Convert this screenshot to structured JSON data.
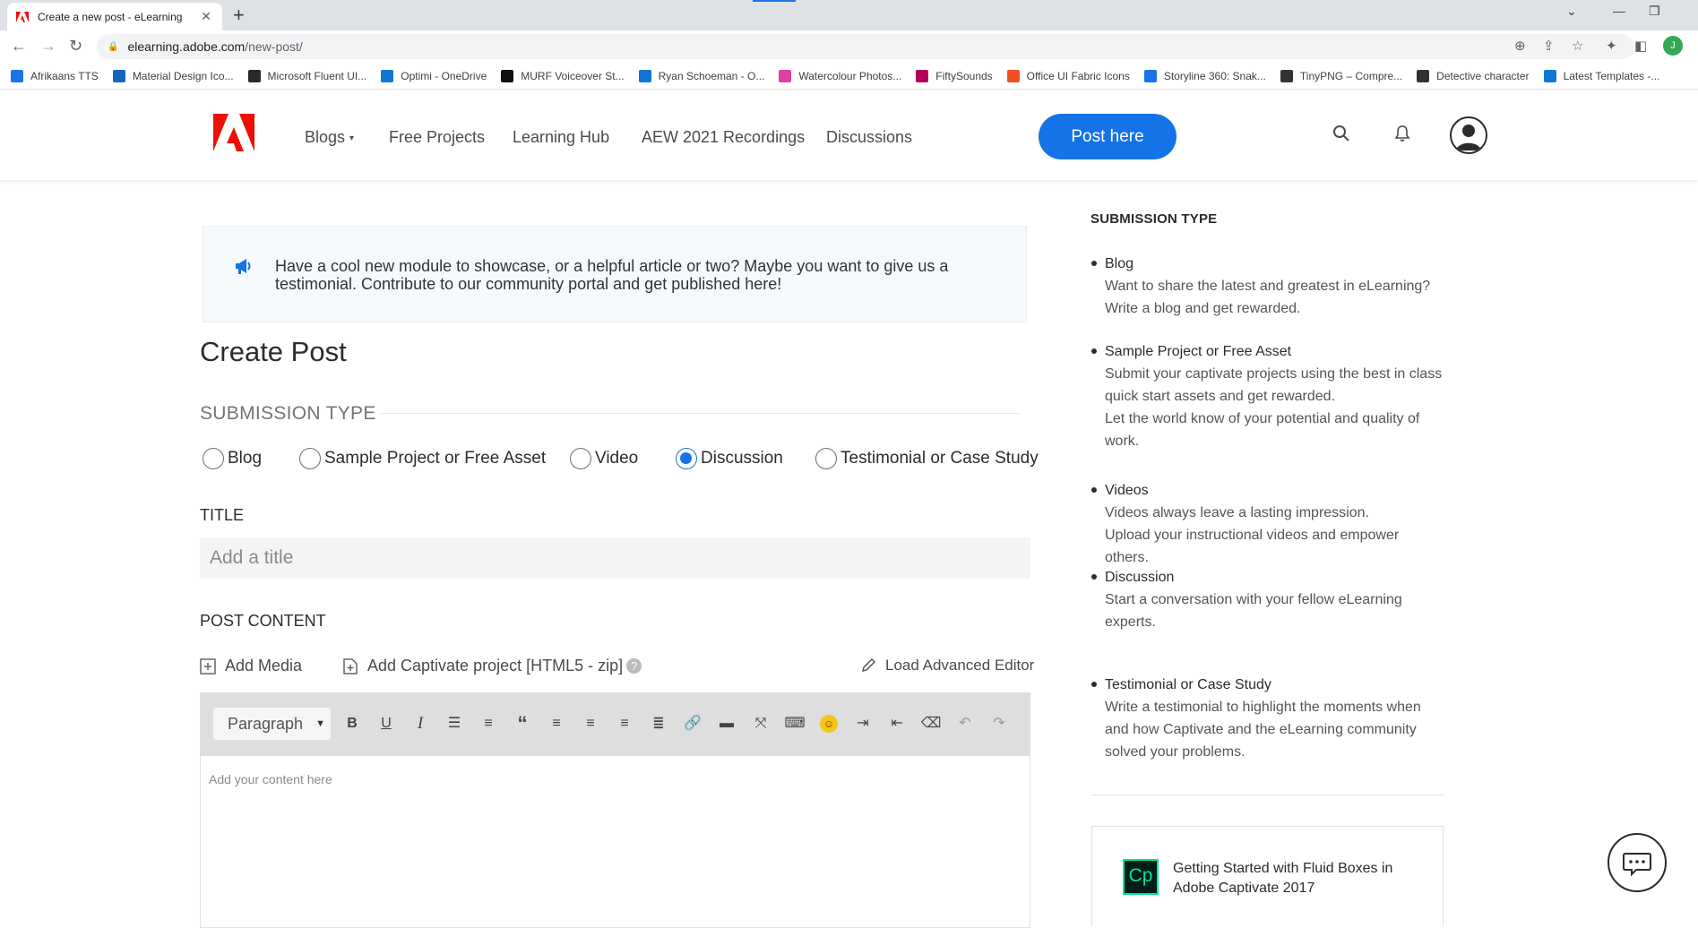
{
  "browser": {
    "tab_title": "Create a new post - eLearning",
    "url_host": "elearning.adobe.com",
    "url_path": "/new-post/",
    "profile_initial": "J",
    "bookmarks": [
      {
        "label": "Afrikaans TTS",
        "color": "#1a73e8"
      },
      {
        "label": "Material Design Ico...",
        "color": "#1565c0"
      },
      {
        "label": "Microsoft Fluent UI...",
        "color": "#24292e"
      },
      {
        "label": "Optimi - OneDrive",
        "color": "#0f78d4"
      },
      {
        "label": "MURF Voiceover St...",
        "color": "#111111"
      },
      {
        "label": "Ryan Schoeman - O...",
        "color": "#0f78d4"
      },
      {
        "label": "Watercolour Photos...",
        "color": "#e040a0"
      },
      {
        "label": "FiftySounds",
        "color": "#b4005a"
      },
      {
        "label": "Office UI Fabric Icons",
        "color": "#f25022"
      },
      {
        "label": "Storyline 360: Snak...",
        "color": "#1a73e8"
      },
      {
        "label": "TinyPNG – Compre...",
        "color": "#333333"
      },
      {
        "label": "Detective character",
        "color": "#333333"
      },
      {
        "label": "Latest Templates -...",
        "color": "#0f78d4"
      }
    ]
  },
  "header": {
    "nav": [
      "Blogs",
      "Free Projects",
      "Learning Hub",
      "AEW 2021 Recordings",
      "Discussions"
    ],
    "post_here": "Post here",
    "accent": "#1473e6",
    "brand_red": "#eb1000"
  },
  "banner": {
    "text": "Have a cool new module to showcase, or a helpful article or two? Maybe you want to give us a testimonial. Contribute to our community portal and get published here!"
  },
  "form": {
    "page_title": "Create Post",
    "submission_label": "SUBMISSION TYPE",
    "types": [
      "Blog",
      "Sample Project or Free Asset",
      "Video",
      "Discussion",
      "Testimonial or Case Study"
    ],
    "selected_type": "Discussion",
    "title_label": "TITLE",
    "title_placeholder": "Add a title",
    "content_label": "POST CONTENT",
    "add_media": "Add Media",
    "add_captivate": "Add Captivate project [HTML5 - zip]",
    "load_editor": "Load Advanced Editor",
    "paragraph": "Paragraph",
    "content_placeholder": "Add your content here"
  },
  "sidebar": {
    "heading": "SUBMISSION TYPE",
    "items": [
      {
        "title": "Blog",
        "lines": [
          "Want to share the latest and greatest in eLearning?",
          "Write a blog and get rewarded."
        ]
      },
      {
        "title": "Sample Project or Free Asset",
        "lines": [
          "Submit your captivate projects using the best in class",
          "quick start assets and get rewarded.",
          "Let the world know of your potential and quality of",
          "work."
        ]
      },
      {
        "title": "Videos",
        "lines": [
          "Videos always leave a lasting impression.",
          "Upload your instructional videos and empower",
          "others."
        ]
      },
      {
        "title": "Discussion",
        "lines": [
          "Start a conversation with your fellow eLearning",
          "experts."
        ]
      },
      {
        "title": "Testimonial or Case Study",
        "lines": [
          "Write a testimonial to highlight the moments when",
          "and how Captivate and the eLearning community",
          "solved your problems."
        ]
      }
    ],
    "card_logo": "Cp",
    "card_title": "Getting Started with Fluid Boxes in Adobe Captivate 2017"
  }
}
